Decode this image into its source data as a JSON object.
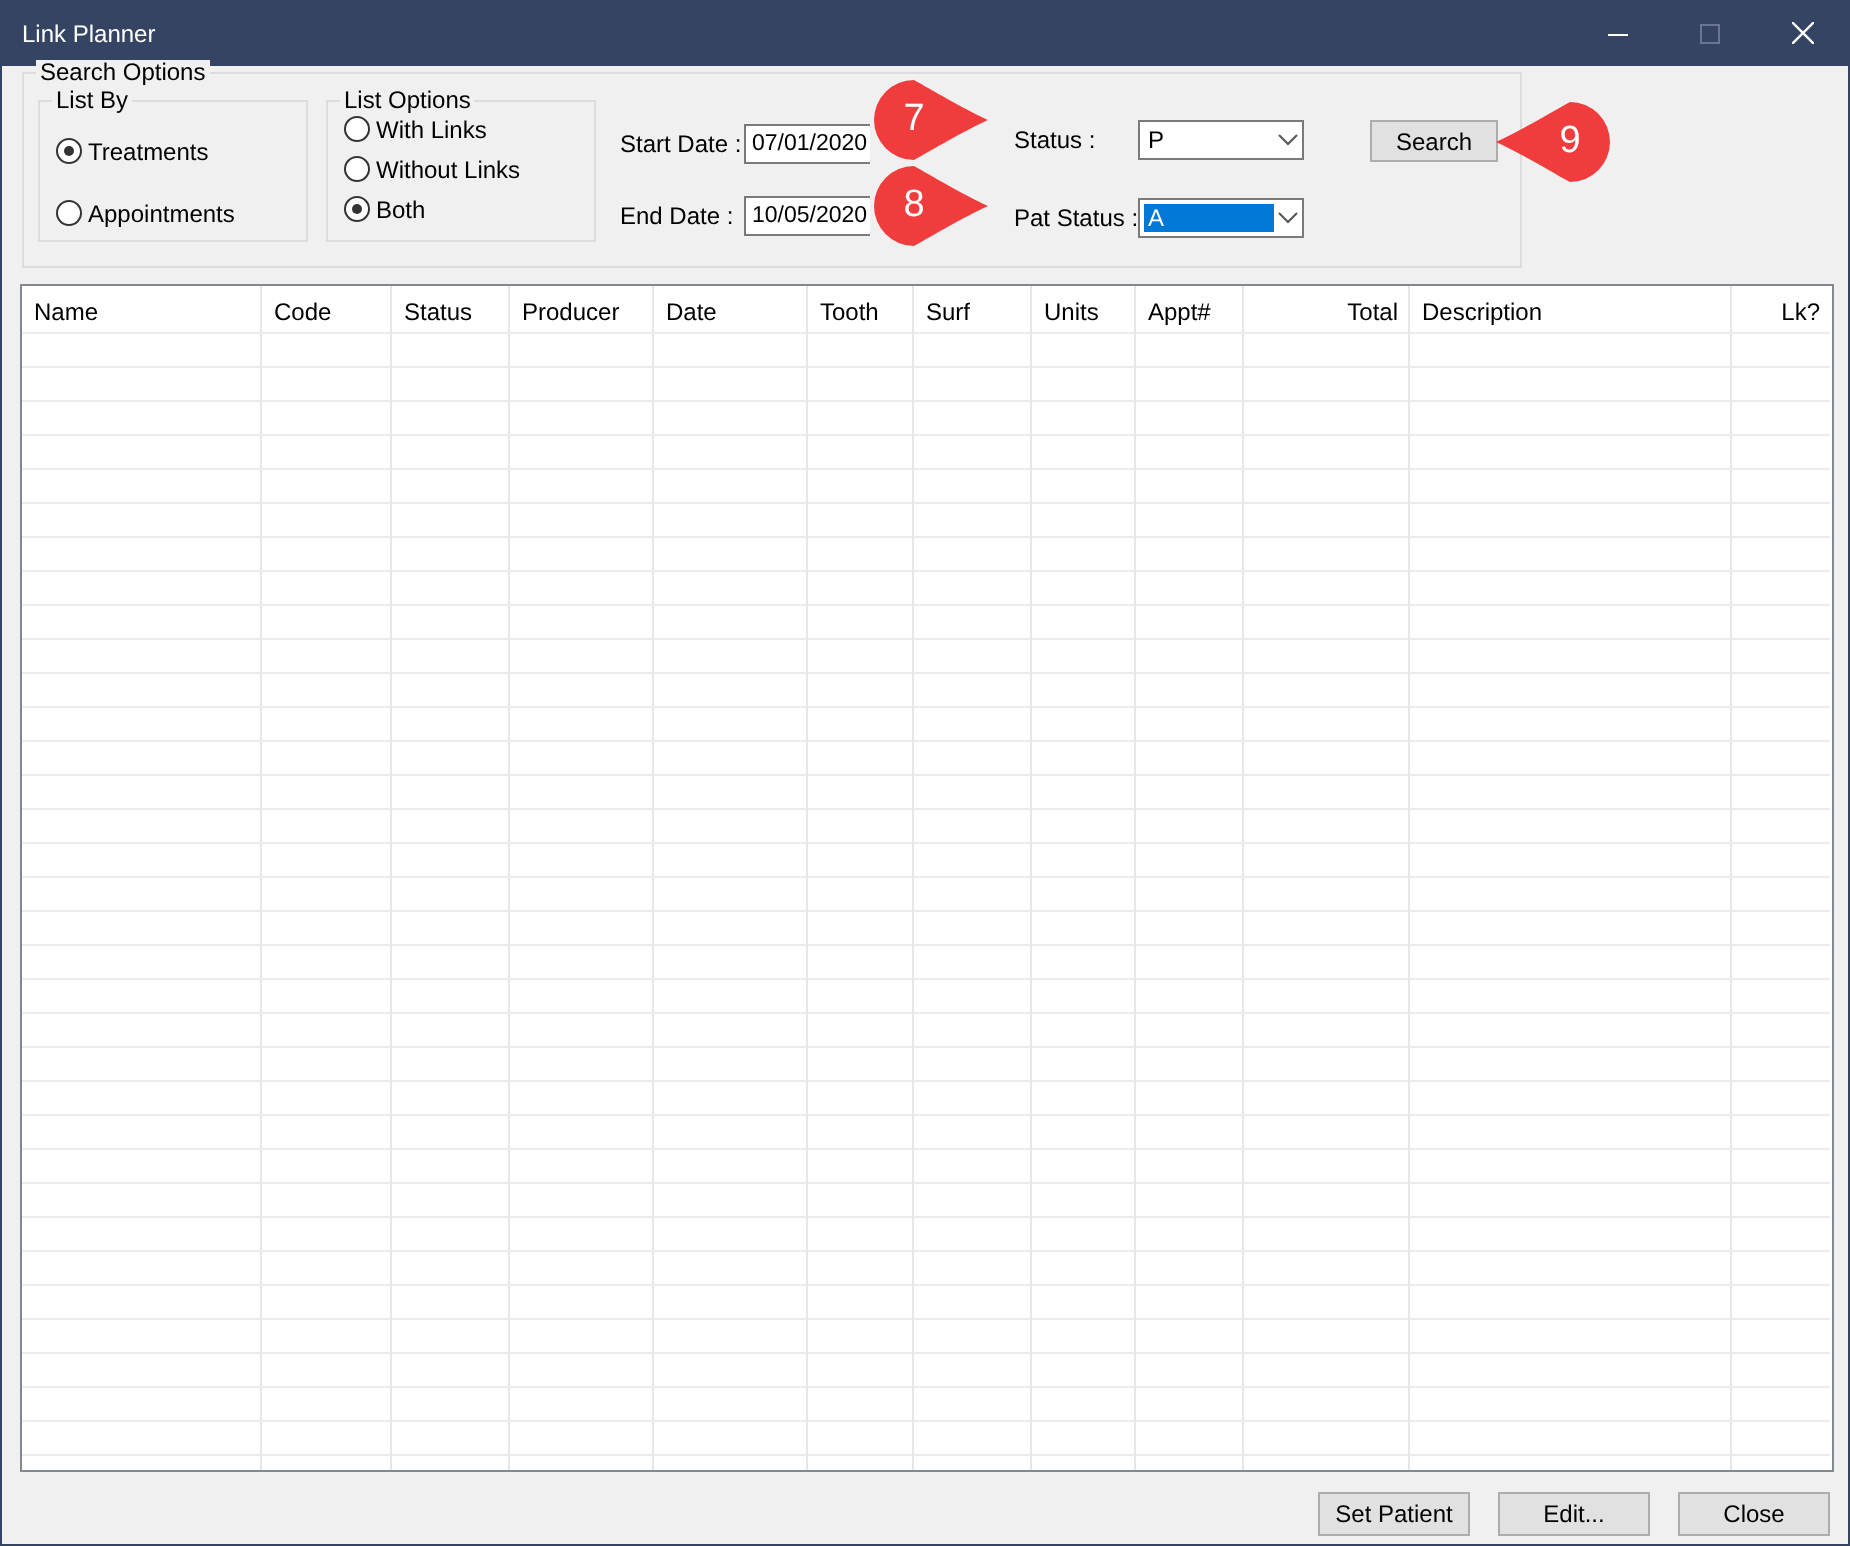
{
  "window": {
    "title": "Link Planner",
    "controls": [
      {
        "kind": "minimize",
        "disabled": false
      },
      {
        "kind": "maximize",
        "disabled": true
      },
      {
        "kind": "close",
        "disabled": false
      }
    ]
  },
  "search_options": {
    "title": "Search Options",
    "list_by": {
      "title": "List By",
      "options": [
        {
          "label": "Treatments",
          "selected": true
        },
        {
          "label": "Appointments",
          "selected": false
        }
      ]
    },
    "list_options": {
      "title": "List Options",
      "options": [
        {
          "label": "With Links",
          "selected": false
        },
        {
          "label": "Without Links",
          "selected": false
        },
        {
          "label": "Both",
          "selected": true
        }
      ]
    },
    "dates": [
      {
        "label": "Start Date :",
        "value": "07/01/2020"
      },
      {
        "label": "End Date :",
        "value": "10/05/2020"
      }
    ],
    "combos": [
      {
        "label": "Status :",
        "value": "P",
        "focused": false
      },
      {
        "label": "Pat Status :",
        "value": "A",
        "focused": true
      }
    ],
    "search_button": "Search"
  },
  "callouts": [
    {
      "number": "7"
    },
    {
      "number": "8"
    },
    {
      "number": "9"
    }
  ],
  "table": {
    "columns": [
      {
        "label": "Name"
      },
      {
        "label": "Code"
      },
      {
        "label": "Status"
      },
      {
        "label": "Producer"
      },
      {
        "label": "Date"
      },
      {
        "label": "Tooth"
      },
      {
        "label": "Surf"
      },
      {
        "label": "Units"
      },
      {
        "label": "Appt#"
      },
      {
        "label": "Total"
      },
      {
        "label": "Description"
      },
      {
        "label": "Lk?"
      }
    ]
  },
  "buttons": [
    "Set Patient",
    "Edit...",
    "Close"
  ]
}
